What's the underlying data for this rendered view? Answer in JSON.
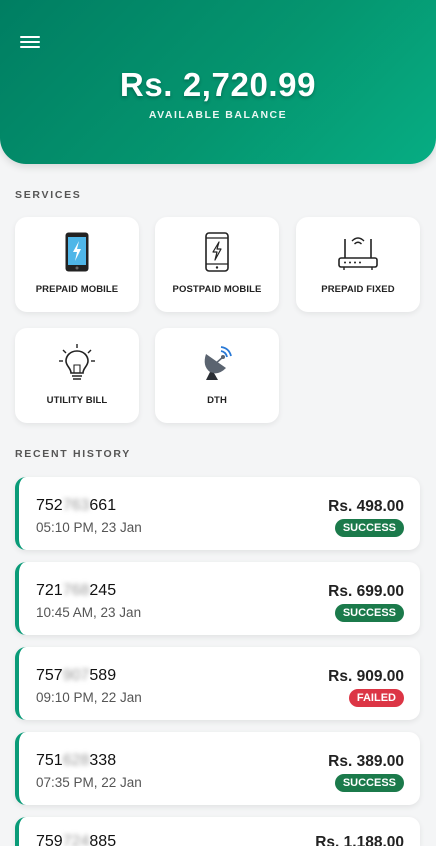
{
  "header": {
    "balance": "Rs. 2,720.99",
    "balance_label": "AVAILABLE BALANCE"
  },
  "services": {
    "title": "SERVICES",
    "items": [
      {
        "label": "PREPAID MOBILE",
        "icon": "prepaid-mobile-icon"
      },
      {
        "label": "POSTPAID MOBILE",
        "icon": "postpaid-mobile-icon"
      },
      {
        "label": "PREPAID FIXED",
        "icon": "router-icon"
      },
      {
        "label": "UTILITY BILL",
        "icon": "lightbulb-icon"
      },
      {
        "label": "DTH",
        "icon": "satellite-dish-icon"
      }
    ]
  },
  "history": {
    "title": "RECENT HISTORY",
    "items": [
      {
        "num_start": "752",
        "num_hidden": "763",
        "num_end": "661",
        "time": "05:10 PM, 23 Jan",
        "amount": "Rs. 498.00",
        "status": "SUCCESS"
      },
      {
        "num_start": "721",
        "num_hidden": "768",
        "num_end": "245",
        "time": "10:45 AM, 23 Jan",
        "amount": "Rs. 699.00",
        "status": "SUCCESS"
      },
      {
        "num_start": "757",
        "num_hidden": "907",
        "num_end": "589",
        "time": "09:10 PM, 22 Jan",
        "amount": "Rs. 909.00",
        "status": "FAILED"
      },
      {
        "num_start": "751",
        "num_hidden": "628",
        "num_end": "338",
        "time": "07:35 PM, 22 Jan",
        "amount": "Rs. 389.00",
        "status": "SUCCESS"
      },
      {
        "num_start": "759",
        "num_hidden": "724",
        "num_end": "885",
        "time": "",
        "amount": "Rs. 1,188.00",
        "status": ""
      }
    ]
  },
  "colors": {
    "primary": "#05956f",
    "success": "#1b7a4b",
    "failed": "#dc3545",
    "card_accent": "#0a9b78"
  }
}
